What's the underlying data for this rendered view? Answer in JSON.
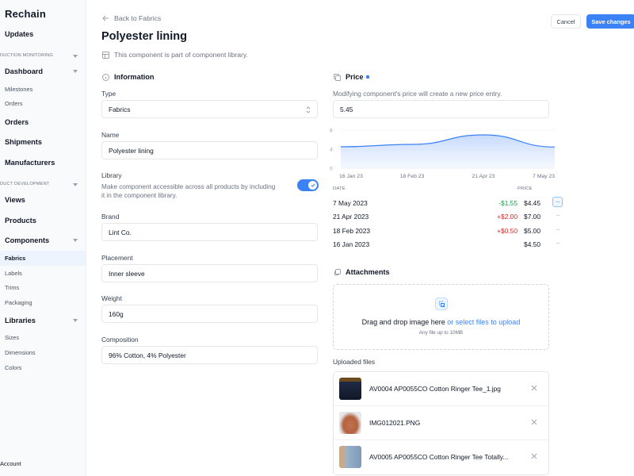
{
  "app": {
    "name": "Rechain"
  },
  "sidebar": {
    "updates": "Updates",
    "section1": "DUCTION MONITORING",
    "dashboard": "Dashboard",
    "dashboard_sub": [
      "Milestones",
      "Orders"
    ],
    "orders": "Orders",
    "shipments": "Shipments",
    "manufacturers": "Manufacturers",
    "section2": "DUCT DEVELOPMENT",
    "views": "Views",
    "products": "Products",
    "components": "Components",
    "components_sub": [
      "Fabrics",
      "Labels",
      "Trims",
      "Packaging"
    ],
    "active_sub": "Fabrics",
    "libraries": "Libraries",
    "libraries_sub": [
      "Sizes",
      "Dimensions",
      "Colors"
    ],
    "account": "Account"
  },
  "header": {
    "back_label": "Back to Fabrics",
    "title": "Polyester lining",
    "library_note": "This component is part of component library.",
    "cancel_label": "Cancel",
    "save_label": "Save changes"
  },
  "information": {
    "heading": "Information",
    "type": {
      "label": "Type",
      "value": "Fabrics"
    },
    "name": {
      "label": "Name",
      "value": "Polyester lining"
    },
    "library": {
      "label": "Library",
      "description": "Make component accessible across all products by including it in the component library.",
      "enabled": true
    },
    "brand": {
      "label": "Brand",
      "value": "Lint Co."
    },
    "placement": {
      "label": "Placement",
      "value": "Inner sleeve"
    },
    "weight": {
      "label": "Weight",
      "value": "160g"
    },
    "composition": {
      "label": "Composition",
      "value": "96% Cotton, 4% Polyester"
    }
  },
  "price": {
    "heading": "Price",
    "note": "Modifying component's price will create a new price entry.",
    "value": "5.45",
    "table_headers": {
      "date": "DATE",
      "price": "PRICE"
    },
    "entries": [
      {
        "date": "7 May 2023",
        "delta": "-$1.55",
        "delta_type": "down",
        "price": "$4.45",
        "active": true
      },
      {
        "date": "21 Apr 2023",
        "delta": "+$2.00",
        "delta_type": "up",
        "price": "$7.00",
        "active": false
      },
      {
        "date": "18 Feb 2023",
        "delta": "+$0.50",
        "delta_type": "up",
        "price": "$5.00",
        "active": false
      },
      {
        "date": "16 Jan 2023",
        "delta": "",
        "delta_type": "none",
        "price": "$4.50",
        "active": false
      }
    ],
    "colors": {
      "up": "#dc2626",
      "down": "#16a34a",
      "accent": "#3b82f6"
    }
  },
  "chart_data": {
    "type": "area",
    "title": "",
    "x": [
      "16 Jan 23",
      "18 Feb 23",
      "21 Apr 23",
      "7 May 23"
    ],
    "values": [
      4.5,
      5.0,
      7.0,
      4.45
    ],
    "yticks": [
      0,
      4,
      8
    ],
    "ylim": [
      0,
      8
    ],
    "grid": true,
    "xlabel": "",
    "ylabel": ""
  },
  "attachments": {
    "heading": "Attachments",
    "drop_text": "Drag and drop image here",
    "drop_link": "or select files to upload",
    "drop_sub": "Any file up to 10MB",
    "uploaded_label": "Uploaded files",
    "files": [
      {
        "name": "AV0004 AP0055CO Cotton Ringer Tee_1.jpg",
        "thumb_color": "#1f2a44"
      },
      {
        "name": "IMG012021.PNG",
        "thumb_color": "#c0714f"
      },
      {
        "name": "AV0005 AP0055CO Cotton Ringer Tee Totally...",
        "thumb_color": "#9db4cc"
      }
    ]
  }
}
